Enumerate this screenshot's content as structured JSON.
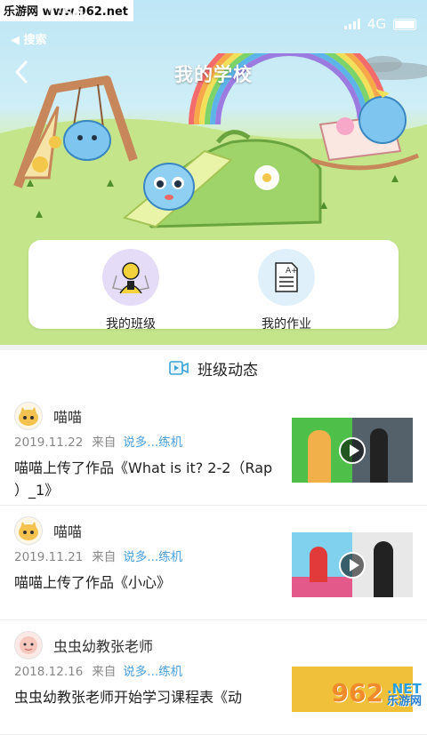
{
  "status_bar": {
    "watermark": "乐游网 www.962.net",
    "time": "11:50",
    "network": "4G",
    "back_app_label": "◀ 搜索"
  },
  "header": {
    "title": "我的学校"
  },
  "menu": [
    {
      "label": "我的班级",
      "icon": "student-icon",
      "color": "#e5ddf8"
    },
    {
      "label": "我的作业",
      "icon": "homework-paper-icon",
      "color": "#dff0fa"
    }
  ],
  "section": {
    "title": "班级动态",
    "icon": "video-icon"
  },
  "feed": [
    {
      "user": "喵喵",
      "avatar": "cat-avatar-icon",
      "date": "2019.11.22",
      "from_label": "来自",
      "source": "说多...练机",
      "text": "喵喵上传了作品《What is it? 2-2（Rap ）_1》"
    },
    {
      "user": "喵喵",
      "avatar": "cat-avatar-icon",
      "date": "2019.11.21",
      "from_label": "来自",
      "source": "说多...练机",
      "text": "喵喵上传了作品《小心》"
    },
    {
      "user": "虫虫幼教张老师",
      "avatar": "teacher-avatar-icon",
      "date": "2018.12.16",
      "from_label": "来自",
      "source": "说多...练机",
      "text": "虫虫幼教张老师开始学习课程表《动"
    }
  ],
  "corner_watermark": {
    "brand": "962",
    "suffix": ".NET",
    "sub": "乐游网"
  },
  "colors": {
    "link": "#4a9fdc",
    "meta": "#888888",
    "card_bg": "#ffffff"
  }
}
